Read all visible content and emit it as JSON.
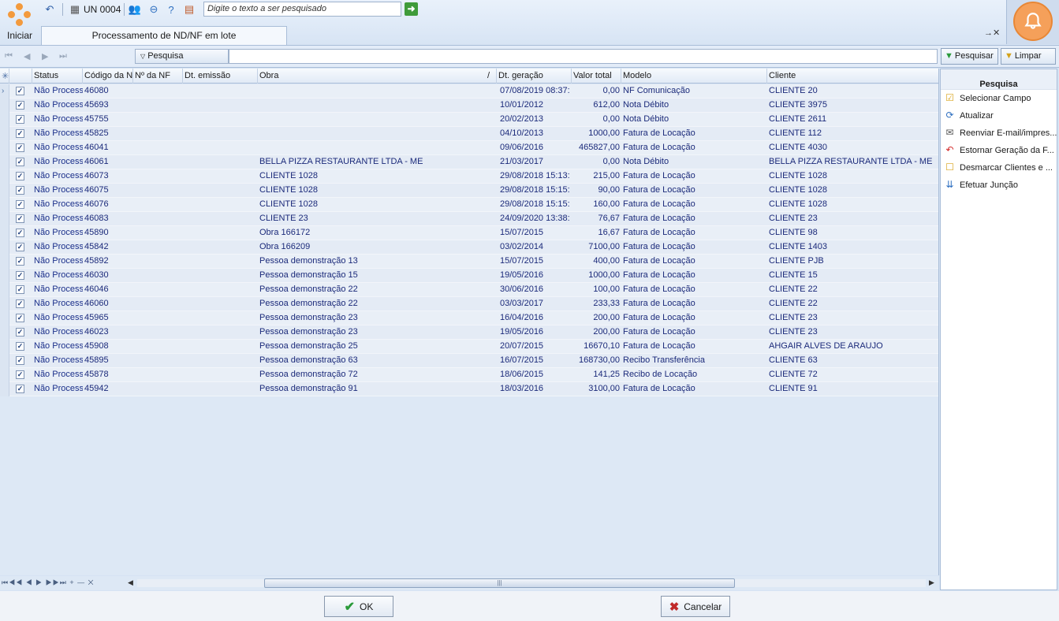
{
  "toolbar": {
    "start_label": "Iniciar",
    "unit_label": "UN 0004",
    "quick_search_placeholder": "Digite o texto a ser pesquisado",
    "tab_title": "Processamento de ND/NF em lote",
    "tab_close": "→✕"
  },
  "icons": {
    "logo": "app-logo-icon",
    "undo": "undo-icon",
    "calculator": "calculator-icon",
    "users": "users-icon",
    "refresh": "refresh-icon",
    "help": "help-icon",
    "report": "report-icon",
    "go": "arrow-right-icon",
    "bell": "bell-icon"
  },
  "colors": {
    "accent_orange": "#f39a3d",
    "grid_text": "#1b2a7a",
    "panel_red": "#d42a2a"
  },
  "search": {
    "field_label": "Pesquisa",
    "value": "",
    "search_button": "Pesquisar",
    "clear_button": "Limpar"
  },
  "grid": {
    "columns": [
      "Status",
      "Código da NI",
      "Nº da NF",
      "Dt. emissão",
      "Obra",
      "Dt. geração",
      "Valor total",
      "Modelo",
      "Cliente"
    ],
    "obra_sort_mark": "/",
    "rows": [
      {
        "status": "Não Process",
        "codigo": "46080",
        "nf": "",
        "emissao": "",
        "obra": "",
        "geracao": "07/08/2019 08:37:",
        "valor": "0,00",
        "modelo": "NF Comunicação",
        "cliente": "CLIENTE 20"
      },
      {
        "status": "Não Process",
        "codigo": "45693",
        "nf": "",
        "emissao": "",
        "obra": "",
        "geracao": "10/01/2012",
        "valor": "612,00",
        "modelo": "Nota Débito",
        "cliente": "CLIENTE  3975"
      },
      {
        "status": "Não Process",
        "codigo": "45755",
        "nf": "",
        "emissao": "",
        "obra": "",
        "geracao": "20/02/2013",
        "valor": "0,00",
        "modelo": "Nota Débito",
        "cliente": "CLIENTE  2611"
      },
      {
        "status": "Não Process",
        "codigo": "45825",
        "nf": "",
        "emissao": "",
        "obra": "",
        "geracao": "04/10/2013",
        "valor": "1000,00",
        "modelo": "Fatura de Locação",
        "cliente": "CLIENTE  112"
      },
      {
        "status": "Não Process",
        "codigo": "46041",
        "nf": "",
        "emissao": "",
        "obra": "",
        "geracao": "09/06/2016",
        "valor": "465827,00",
        "modelo": "Fatura de Locação",
        "cliente": "CLIENTE 4030"
      },
      {
        "status": "Não Process",
        "codigo": "46061",
        "nf": "",
        "emissao": "",
        "obra": "BELLA PIZZA RESTAURANTE LTDA - ME",
        "geracao": "21/03/2017",
        "valor": "0,00",
        "modelo": "Nota Débito",
        "cliente": "BELLA PIZZA RESTAURANTE LTDA - ME"
      },
      {
        "status": "Não Process",
        "codigo": "46073",
        "nf": "",
        "emissao": "",
        "obra": "CLIENTE  1028",
        "geracao": "29/08/2018 15:13:",
        "valor": "215,00",
        "modelo": "Fatura de Locação",
        "cliente": "CLIENTE  1028"
      },
      {
        "status": "Não Process",
        "codigo": "46075",
        "nf": "",
        "emissao": "",
        "obra": "CLIENTE  1028",
        "geracao": "29/08/2018 15:15:",
        "valor": "90,00",
        "modelo": "Fatura de Locação",
        "cliente": "CLIENTE  1028"
      },
      {
        "status": "Não Process",
        "codigo": "46076",
        "nf": "",
        "emissao": "",
        "obra": "CLIENTE  1028",
        "geracao": "29/08/2018 15:15:",
        "valor": "160,00",
        "modelo": "Fatura de Locação",
        "cliente": "CLIENTE  1028"
      },
      {
        "status": "Não Process",
        "codigo": "46083",
        "nf": "",
        "emissao": "",
        "obra": "CLIENTE 23",
        "geracao": "24/09/2020 13:38:",
        "valor": "76,67",
        "modelo": "Fatura de Locação",
        "cliente": "CLIENTE 23"
      },
      {
        "status": "Não Process",
        "codigo": "45890",
        "nf": "",
        "emissao": "",
        "obra": "Obra 166172",
        "geracao": "15/07/2015",
        "valor": "16,67",
        "modelo": "Fatura de Locação",
        "cliente": "CLIENTE  98"
      },
      {
        "status": "Não Process",
        "codigo": "45842",
        "nf": "",
        "emissao": "",
        "obra": "Obra 166209",
        "geracao": "03/02/2014",
        "valor": "7100,00",
        "modelo": "Fatura de Locação",
        "cliente": "CLIENTE  1403"
      },
      {
        "status": "Não Process",
        "codigo": "45892",
        "nf": "",
        "emissao": "",
        "obra": "Pessoa demonstração 13",
        "geracao": "15/07/2015",
        "valor": "400,00",
        "modelo": "Fatura de Locação",
        "cliente": "CLIENTE PJB"
      },
      {
        "status": "Não Process",
        "codigo": "46030",
        "nf": "",
        "emissao": "",
        "obra": "Pessoa demonstração 15",
        "geracao": "19/05/2016",
        "valor": "1000,00",
        "modelo": "Fatura de Locação",
        "cliente": "CLIENTE 15"
      },
      {
        "status": "Não Process",
        "codigo": "46046",
        "nf": "",
        "emissao": "",
        "obra": "Pessoa demonstração 22",
        "geracao": "30/06/2016",
        "valor": "100,00",
        "modelo": "Fatura de Locação",
        "cliente": "CLIENTE 22"
      },
      {
        "status": "Não Process",
        "codigo": "46060",
        "nf": "",
        "emissao": "",
        "obra": "Pessoa demonstração 22",
        "geracao": "03/03/2017",
        "valor": "233,33",
        "modelo": "Fatura de Locação",
        "cliente": "CLIENTE 22"
      },
      {
        "status": "Não Process",
        "codigo": "45965",
        "nf": "",
        "emissao": "",
        "obra": "Pessoa demonstração 23",
        "geracao": "16/04/2016",
        "valor": "200,00",
        "modelo": "Fatura de Locação",
        "cliente": "CLIENTE 23"
      },
      {
        "status": "Não Process",
        "codigo": "46023",
        "nf": "",
        "emissao": "",
        "obra": "Pessoa demonstração 23",
        "geracao": "19/05/2016",
        "valor": "200,00",
        "modelo": "Fatura de Locação",
        "cliente": "CLIENTE 23"
      },
      {
        "status": "Não Process",
        "codigo": "45908",
        "nf": "",
        "emissao": "",
        "obra": "Pessoa demonstração 25",
        "geracao": "20/07/2015",
        "valor": "16670,10",
        "modelo": "Fatura de Locação",
        "cliente": "AHGAIR ALVES DE ARAUJO"
      },
      {
        "status": "Não Process",
        "codigo": "45895",
        "nf": "",
        "emissao": "",
        "obra": "Pessoa demonstração 63",
        "geracao": "16/07/2015",
        "valor": "168730,00",
        "modelo": "Recibo Transferência",
        "cliente": "CLIENTE  63"
      },
      {
        "status": "Não Process",
        "codigo": "45878",
        "nf": "",
        "emissao": "",
        "obra": "Pessoa demonstração 72",
        "geracao": "18/06/2015",
        "valor": "141,25",
        "modelo": "Recibo de Locação",
        "cliente": "CLIENTE  72"
      },
      {
        "status": "Não Process",
        "codigo": "45942",
        "nf": "",
        "emissao": "",
        "obra": "Pessoa demonstração 91",
        "geracao": "18/03/2016",
        "valor": "3100,00",
        "modelo": "Fatura de Locação",
        "cliente": "CLIENTE  91"
      }
    ],
    "footer_nav": "⏮◀◀ ◀ ▶ ▶▶⏭ + — ✕"
  },
  "panel": {
    "title": "Pesquisa",
    "items": [
      {
        "label": "Selecionar Campo",
        "icon": "select-field-icon",
        "glyph": "☑"
      },
      {
        "label": "Atualizar",
        "icon": "refresh-icon",
        "glyph": "⟳"
      },
      {
        "label": "Reenviar E-mail/impres...",
        "icon": "email-resend-icon",
        "glyph": "✉"
      },
      {
        "label": "Estornar Geração da F...",
        "icon": "reverse-icon",
        "glyph": "↶"
      },
      {
        "label": "Desmarcar Clientes e ...",
        "icon": "uncheck-clients-icon",
        "glyph": "☐"
      },
      {
        "label": "Efetuar Junção",
        "icon": "join-icon",
        "glyph": "⇊"
      }
    ]
  },
  "dialog": {
    "ok_label": "OK",
    "cancel_label": "Cancelar"
  }
}
